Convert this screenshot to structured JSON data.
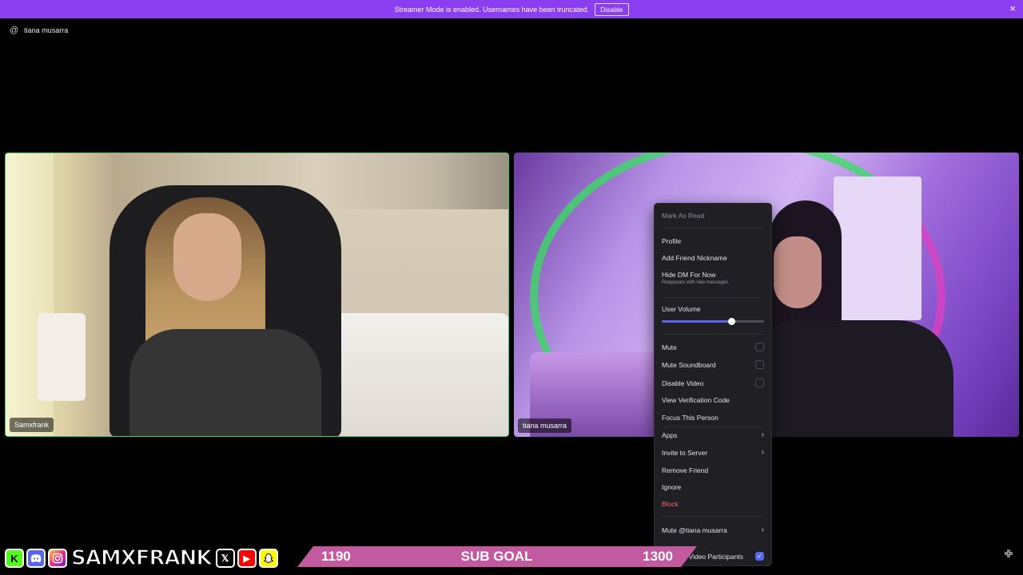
{
  "banner": {
    "message": "Streamer Mode is enabled. Usernames have been truncated.",
    "disable_label": "Disable",
    "close_icon": "×"
  },
  "dm_header": {
    "at_icon": "@",
    "name": "tiana musarra"
  },
  "tiles": [
    {
      "name": "Samxfrank",
      "speaking": true
    },
    {
      "name": "tiana musarra",
      "speaking": false
    }
  ],
  "context_menu": {
    "mark_as_read": "Mark As Read",
    "profile": "Profile",
    "add_friend_nickname": "Add Friend Nickname",
    "hide_dm": "Hide DM For Now",
    "hide_dm_sub": "Reappears with new messages",
    "user_volume": "User Volume",
    "user_volume_level": 0.68,
    "mute": "Mute",
    "mute_soundboard": "Mute Soundboard",
    "disable_video": "Disable Video",
    "view_verification_code": "View Verification Code",
    "focus_this_person": "Focus This Person",
    "apps": "Apps",
    "invite_to_server": "Invite to Server",
    "remove_friend": "Remove Friend",
    "ignore": "Ignore",
    "block": "Block",
    "mute_user": "Mute @tiana musarra",
    "non_video": "n-Video Participants",
    "chevron": "›",
    "check": "✓"
  },
  "overlay": {
    "brand": "SAMXFRANK",
    "icons": {
      "kick": "K",
      "discord": "discord-icon",
      "instagram": "instagram-icon",
      "x": "𝕏",
      "youtube": "▶",
      "snapchat": "snapchat-icon"
    },
    "sub_goal_current": "1190",
    "sub_goal_label": "SUB GOAL",
    "sub_goal_target": "1300"
  },
  "colors": {
    "banner": "#8b3df0",
    "speaking_border": "#3fd068",
    "accent": "#5865f2",
    "danger": "#f06a75",
    "sub_goal": "#c15a9e"
  }
}
